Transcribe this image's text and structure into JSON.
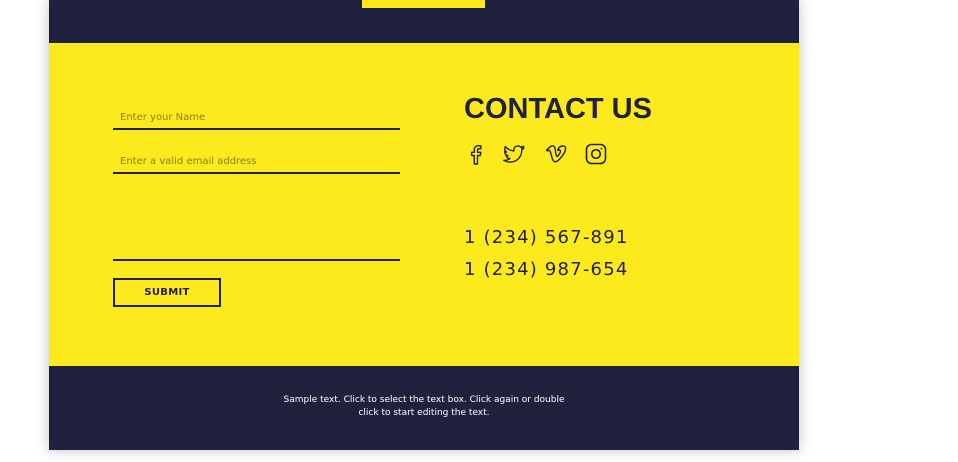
{
  "form": {
    "name_placeholder": "Enter your Name",
    "email_placeholder": "Enter a valid email address",
    "message_placeholder": "",
    "submit_label": "SUBMIT"
  },
  "contact": {
    "title": "CONTACT US",
    "phones": [
      "1 (234) 567-891",
      "1 (234) 987-654"
    ],
    "social_icons": [
      "facebook-icon",
      "twitter-icon",
      "vimeo-icon",
      "instagram-icon"
    ]
  },
  "footer": {
    "text_line1": "Sample text. Click to select the text box. Click again or double",
    "text_line2": "click to start editing the text."
  },
  "colors": {
    "dark": "#20213d",
    "yellow": "#fdea1d",
    "white": "#ffffff"
  }
}
